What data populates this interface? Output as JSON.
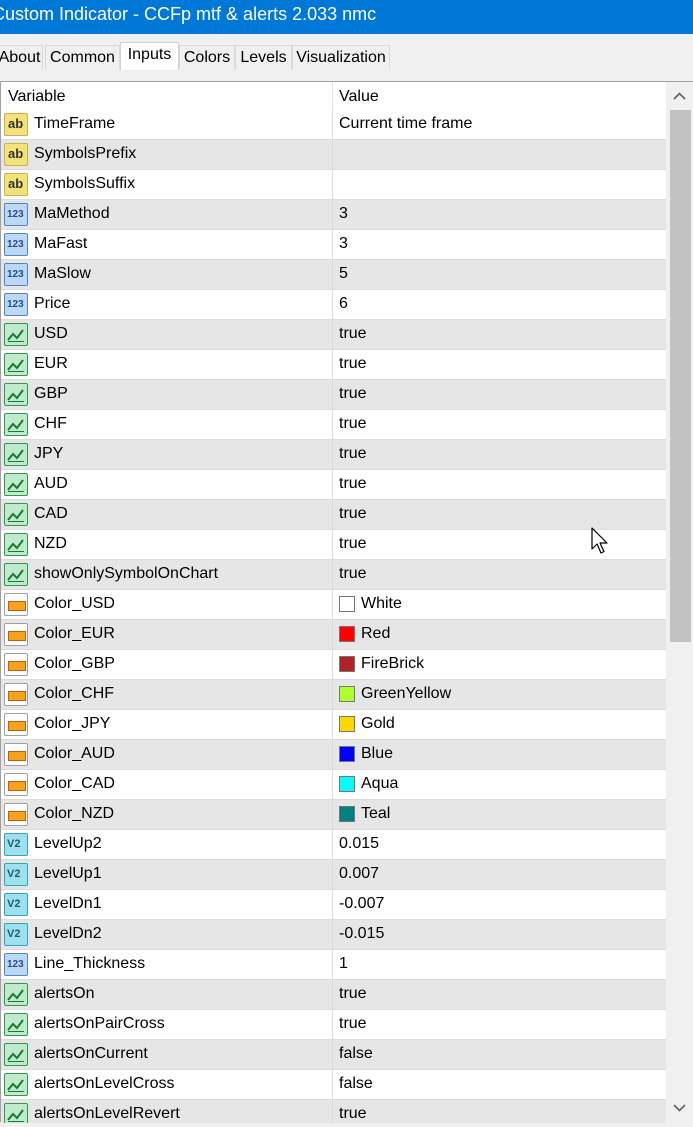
{
  "window": {
    "title": "Custom Indicator - CCFp mtf & alerts 2.033 nmc"
  },
  "tabs": [
    {
      "label": "About"
    },
    {
      "label": "Common"
    },
    {
      "label": "Inputs",
      "active": true
    },
    {
      "label": "Colors"
    },
    {
      "label": "Levels"
    },
    {
      "label": "Visualization"
    }
  ],
  "table": {
    "headers": {
      "variable": "Variable",
      "value": "Value"
    },
    "rows": [
      {
        "icon": "string-icon",
        "name": "TimeFrame",
        "value": "Current time frame"
      },
      {
        "icon": "string-icon",
        "name": "SymbolsPrefix",
        "value": ""
      },
      {
        "icon": "string-icon",
        "name": "SymbolsSuffix",
        "value": ""
      },
      {
        "icon": "integer-icon",
        "name": "MaMethod",
        "value": "3"
      },
      {
        "icon": "integer-icon",
        "name": "MaFast",
        "value": "3"
      },
      {
        "icon": "integer-icon",
        "name": "MaSlow",
        "value": "5"
      },
      {
        "icon": "integer-icon",
        "name": "Price",
        "value": "6"
      },
      {
        "icon": "bool-icon",
        "name": "USD",
        "value": "true"
      },
      {
        "icon": "bool-icon",
        "name": "EUR",
        "value": "true"
      },
      {
        "icon": "bool-icon",
        "name": "GBP",
        "value": "true"
      },
      {
        "icon": "bool-icon",
        "name": "CHF",
        "value": "true"
      },
      {
        "icon": "bool-icon",
        "name": "JPY",
        "value": "true"
      },
      {
        "icon": "bool-icon",
        "name": "AUD",
        "value": "true"
      },
      {
        "icon": "bool-icon",
        "name": "CAD",
        "value": "true"
      },
      {
        "icon": "bool-icon",
        "name": "NZD",
        "value": "true"
      },
      {
        "icon": "bool-icon",
        "name": "showOnlySymbolOnChart",
        "value": "true"
      },
      {
        "icon": "color-icon",
        "name": "Color_USD",
        "value": "White",
        "color": "#ffffff"
      },
      {
        "icon": "color-icon",
        "name": "Color_EUR",
        "value": "Red",
        "color": "#ff0000"
      },
      {
        "icon": "color-icon",
        "name": "Color_GBP",
        "value": "FireBrick",
        "color": "#b22222"
      },
      {
        "icon": "color-icon",
        "name": "Color_CHF",
        "value": "GreenYellow",
        "color": "#adff2f"
      },
      {
        "icon": "color-icon",
        "name": "Color_JPY",
        "value": "Gold",
        "color": "#ffd700"
      },
      {
        "icon": "color-icon",
        "name": "Color_AUD",
        "value": "Blue",
        "color": "#0000ff"
      },
      {
        "icon": "color-icon",
        "name": "Color_CAD",
        "value": "Aqua",
        "color": "#00ffff"
      },
      {
        "icon": "color-icon",
        "name": "Color_NZD",
        "value": "Teal",
        "color": "#008080"
      },
      {
        "icon": "double-icon",
        "name": "LevelUp2",
        "value": "0.015"
      },
      {
        "icon": "double-icon",
        "name": "LevelUp1",
        "value": "0.007"
      },
      {
        "icon": "double-icon",
        "name": "LevelDn1",
        "value": "-0.007"
      },
      {
        "icon": "double-icon",
        "name": "LevelDn2",
        "value": "-0.015"
      },
      {
        "icon": "integer-icon",
        "name": "Line_Thickness",
        "value": "1"
      },
      {
        "icon": "bool-icon",
        "name": "alertsOn",
        "value": "true"
      },
      {
        "icon": "bool-icon",
        "name": "alertsOnPairCross",
        "value": "true"
      },
      {
        "icon": "bool-icon",
        "name": "alertsOnCurrent",
        "value": "false"
      },
      {
        "icon": "bool-icon",
        "name": "alertsOnLevelCross",
        "value": "false"
      },
      {
        "icon": "bool-icon",
        "name": "alertsOnLevelRevert",
        "value": "true"
      }
    ]
  },
  "icons": {
    "string": {
      "glyph": "ab"
    },
    "integer": {
      "glyph": "123"
    },
    "double": {
      "glyph": "V2"
    }
  },
  "colors": {
    "titlebar": "#0078d7"
  }
}
